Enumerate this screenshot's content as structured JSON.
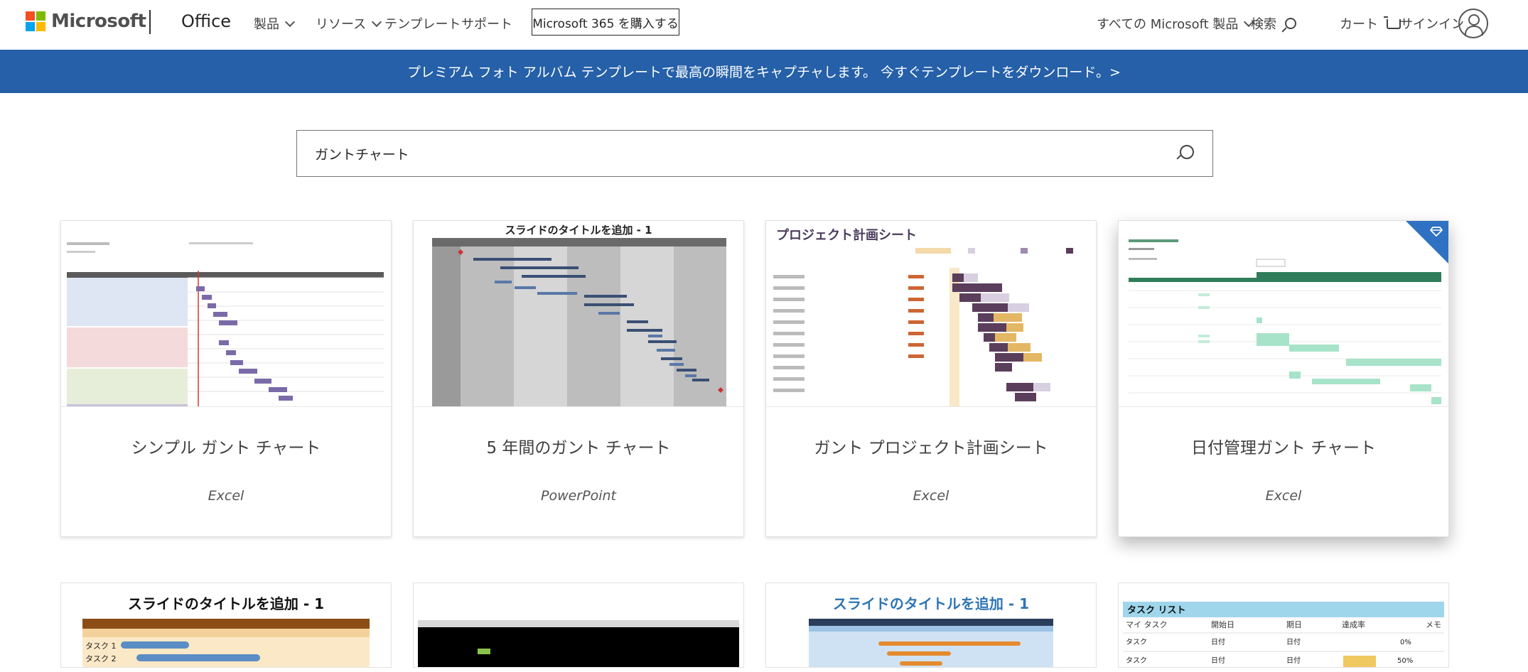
{
  "nav": {
    "brand": "Microsoft",
    "office": "Office",
    "links": [
      "製品",
      "リソース",
      "テンプレート",
      "サポート"
    ],
    "buy_label": "Microsoft 365 を購入する",
    "all_products": "すべての Microsoft 製品",
    "search_label": "検索",
    "cart_label": "カート",
    "signin_label": "サインイン"
  },
  "banner": {
    "text": "プレミアム フォト アルバム テンプレートで最高の瞬間をキャプチャします。 今すぐテンプレートをダウンロード。>"
  },
  "search": {
    "value": "ガントチャート"
  },
  "cards": [
    {
      "title": "シンプル ガント チャート",
      "app": "Excel",
      "thumb_header": ""
    },
    {
      "title": "5 年間のガント チャート",
      "app": "PowerPoint",
      "thumb_header": "スライドのタイトルを追加 - 1"
    },
    {
      "title": "ガント プロジェクト計画シート",
      "app": "Excel",
      "thumb_header": "プロジェクト計画シート"
    },
    {
      "title": "日付管理ガント チャート",
      "app": "Excel",
      "thumb_header": "",
      "premium": true
    }
  ],
  "row2": [
    {
      "thumb_header": "スライドのタイトルを追加 - 1",
      "rows": [
        "タスク 1",
        "タスク 2"
      ]
    },
    {
      "thumb_header": ""
    },
    {
      "thumb_header": "スライドのタイトルを追加 - 1"
    },
    {
      "thumb_header": "タスク リスト",
      "cols": [
        "マイ タスク",
        "開始日",
        "期日",
        "達成率",
        "メモ"
      ],
      "cells": [
        "タスク",
        "日付",
        "日付",
        "0%",
        "タスク",
        "日付",
        "日付",
        "50%"
      ]
    }
  ],
  "colors": {
    "banner": "#2560a8",
    "premium": "#2f71c2"
  }
}
